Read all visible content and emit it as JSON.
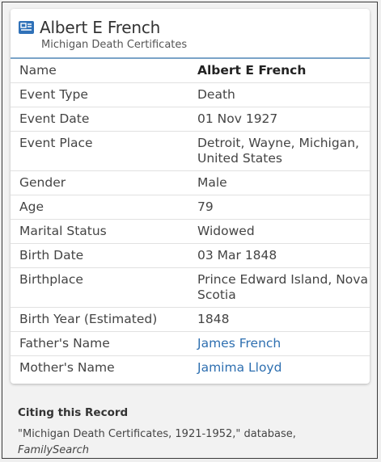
{
  "record": {
    "name": "Albert E French",
    "collection": "Michigan Death Certificates"
  },
  "facts": [
    {
      "label": "Name",
      "value": "Albert E French"
    },
    {
      "label": "Event Type",
      "value": "Death"
    },
    {
      "label": "Event Date",
      "value": "01 Nov 1927"
    },
    {
      "label": "Event Place",
      "value": "Detroit, Wayne, Michigan, United States"
    },
    {
      "label": "Gender",
      "value": "Male"
    },
    {
      "label": "Age",
      "value": "79"
    },
    {
      "label": "Marital Status",
      "value": "Widowed"
    },
    {
      "label": "Birth Date",
      "value": "03 Mar 1848"
    },
    {
      "label": "Birthplace",
      "value": "Prince Edward Island, Nova Scotia"
    },
    {
      "label": "Birth Year (Estimated)",
      "value": "1848"
    },
    {
      "label": "Father's Name",
      "value": "James French"
    },
    {
      "label": "Mother's Name",
      "value": "Jamima Lloyd"
    }
  ],
  "citing": {
    "title": "Citing this Record",
    "text": "\"Michigan Death Certificates, 1921-1952,\" database,",
    "source": "FamilySearch"
  },
  "colors": {
    "accent": "#2f71b8",
    "link": "#2e6fb0",
    "header_rule": "#7aa3c8"
  },
  "icons": {
    "record": "record-card-icon"
  }
}
